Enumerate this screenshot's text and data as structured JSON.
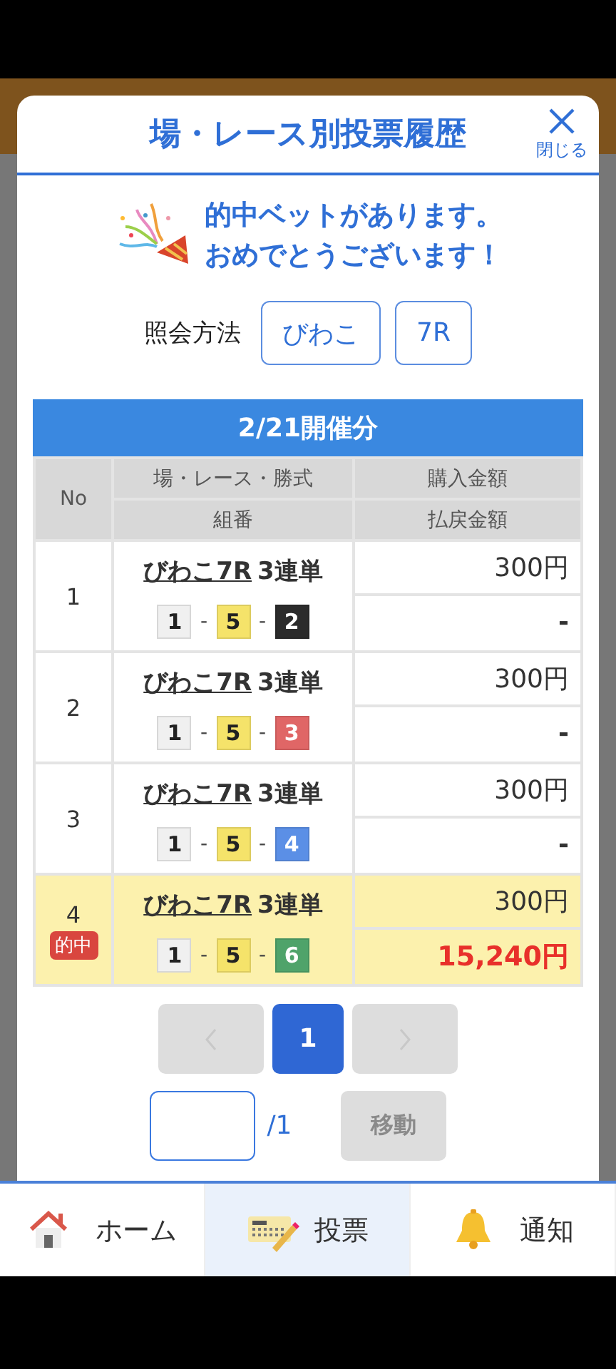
{
  "dialog": {
    "title": "場・レース別投票履歴",
    "close_label": "閉じる"
  },
  "message": {
    "lines": [
      "的中ベットがあります。",
      "おめでとうございます！"
    ]
  },
  "query": {
    "label": "照会方法",
    "buttons": [
      "びわこ",
      "7R"
    ]
  },
  "table": {
    "heading": "2/21開催分",
    "columns": [
      "No",
      "場・レース・勝式",
      "組番",
      "購入金額",
      "払戻金額"
    ],
    "rows": [
      {
        "no": "1",
        "race": "びわこ7R",
        "bet_type": "3連単",
        "hit": false,
        "separator": "-",
        "balls": [
          {
            "number": "1",
            "color": "#f0f0f0"
          },
          {
            "number": "5",
            "color": "#f5e36a"
          },
          {
            "number": "2",
            "color": "#2b2b2b"
          }
        ],
        "purchase": "300円",
        "payout": "-"
      },
      {
        "no": "2",
        "race": "びわこ7R",
        "bet_type": "3連単",
        "hit": false,
        "separator": "-",
        "balls": [
          {
            "number": "1",
            "color": "#f0f0f0"
          },
          {
            "number": "5",
            "color": "#f5e36a"
          },
          {
            "number": "3",
            "color": "#e06666"
          }
        ],
        "purchase": "300円",
        "payout": "-"
      },
      {
        "no": "3",
        "race": "びわこ7R",
        "bet_type": "3連単",
        "hit": false,
        "separator": "-",
        "balls": [
          {
            "number": "1",
            "color": "#f0f0f0"
          },
          {
            "number": "5",
            "color": "#f5e36a"
          },
          {
            "number": "4",
            "color": "#5b8fe6"
          }
        ],
        "purchase": "300円",
        "payout": "-"
      },
      {
        "no": "4",
        "race": "びわこ7R",
        "bet_type": "3連単",
        "hit": true,
        "separator": "-",
        "badge": "的中",
        "balls": [
          {
            "number": "1",
            "color": "#f0f0f0"
          },
          {
            "number": "5",
            "color": "#f5e36a"
          },
          {
            "number": "6",
            "color": "#4fa36a"
          }
        ],
        "purchase": "300円",
        "payout": "15,240円"
      }
    ]
  },
  "pagination": {
    "prev_disabled": true,
    "next_disabled": true,
    "pages": [
      {
        "label": "1",
        "selected": true
      }
    ],
    "total": "/1",
    "go_label": "移動",
    "go_disabled": true
  },
  "nav": [
    {
      "kind": "home",
      "label": "ホーム",
      "selected": false
    },
    {
      "kind": "vote",
      "label": "投票",
      "selected": true
    },
    {
      "kind": "notify",
      "label": "通知",
      "selected": false
    }
  ]
}
